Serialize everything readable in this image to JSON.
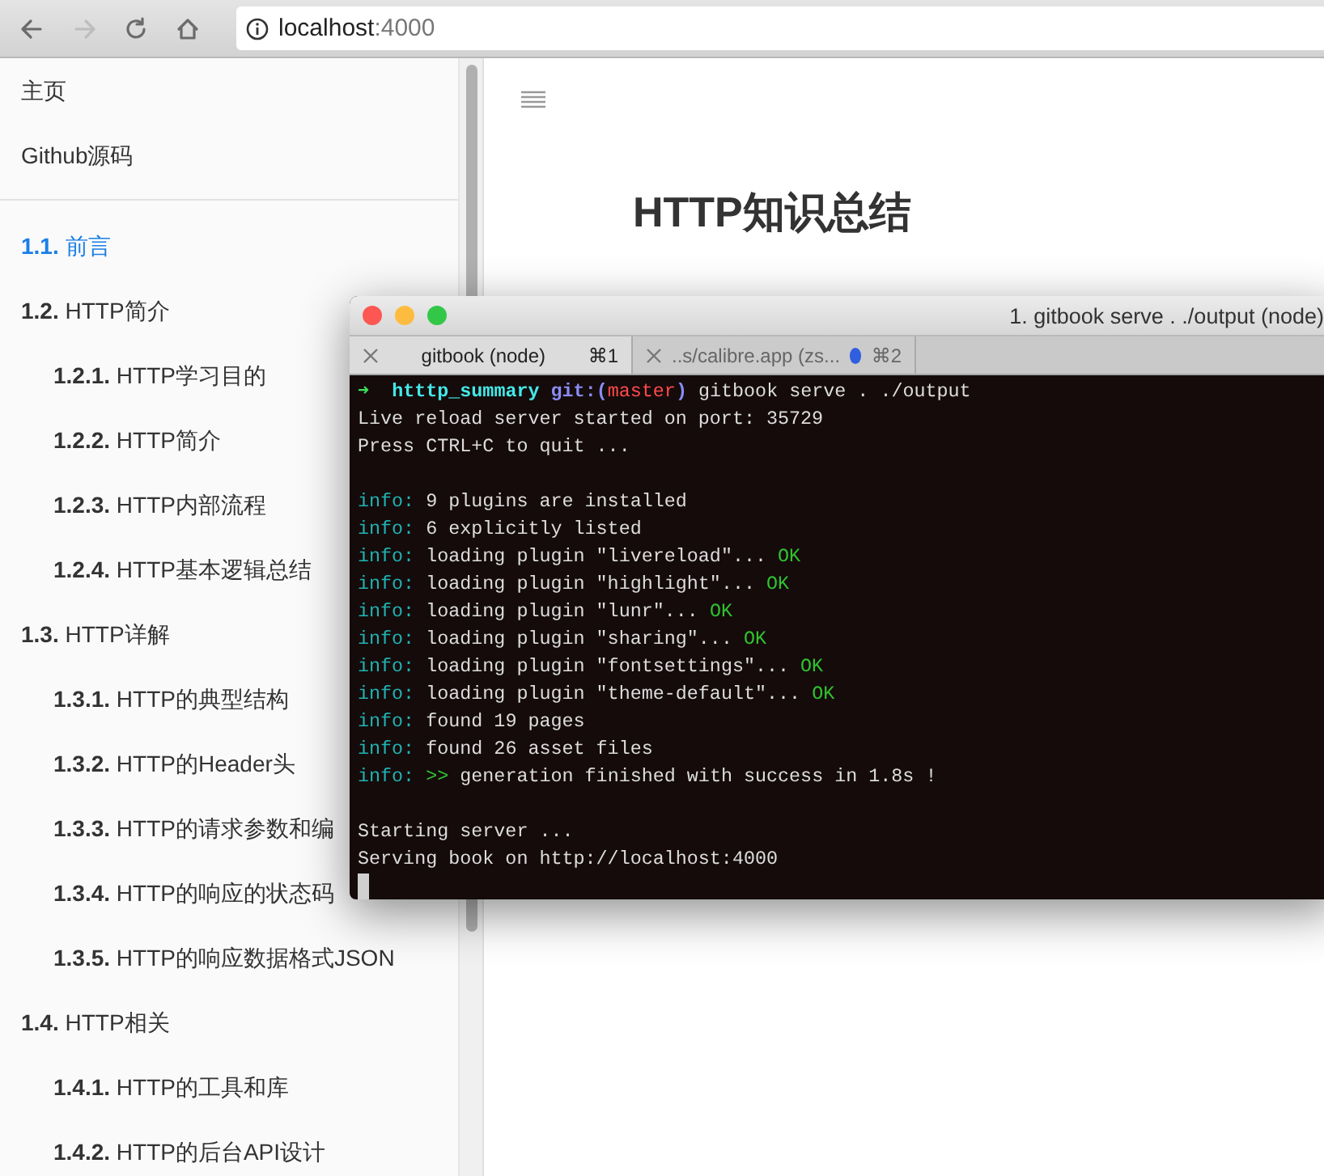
{
  "browser": {
    "nav": [
      {
        "kind": "back",
        "disabled": false
      },
      {
        "kind": "forward",
        "disabled": true
      },
      {
        "kind": "reload",
        "disabled": false
      },
      {
        "kind": "home",
        "disabled": false
      }
    ],
    "address": {
      "host": "localhost",
      "port": ":4000"
    }
  },
  "sidebar": {
    "links": [
      {
        "label": "主页"
      },
      {
        "label": "Github源码"
      }
    ],
    "items": [
      {
        "number": "1.1.",
        "label": "前言",
        "selected": true
      },
      {
        "number": "1.2.",
        "label": "HTTP简介",
        "selected": false,
        "children": [
          {
            "number": "1.2.1.",
            "label": "HTTP学习目的",
            "selected": false
          },
          {
            "number": "1.2.2.",
            "label": "HTTP简介",
            "selected": false
          },
          {
            "number": "1.2.3.",
            "label": "HTTP内部流程",
            "selected": false
          },
          {
            "number": "1.2.4.",
            "label": "HTTP基本逻辑总结",
            "selected": false
          }
        ]
      },
      {
        "number": "1.3.",
        "label": "HTTP详解",
        "selected": false,
        "children": [
          {
            "number": "1.3.1.",
            "label": "HTTP的典型结构",
            "selected": false
          },
          {
            "number": "1.3.2.",
            "label": "HTTP的Header头",
            "selected": false
          },
          {
            "number": "1.3.3.",
            "label": "HTTP的请求参数和编",
            "selected": false
          },
          {
            "number": "1.3.4.",
            "label": "HTTP的响应的状态码",
            "selected": false
          },
          {
            "number": "1.3.5.",
            "label": "HTTP的响应数据格式JSON",
            "selected": false
          }
        ]
      },
      {
        "number": "1.4.",
        "label": "HTTP相关",
        "selected": false,
        "children": [
          {
            "number": "1.4.1.",
            "label": "HTTP的工具和库",
            "selected": false
          },
          {
            "number": "1.4.2.",
            "label": "HTTP的后台API设计",
            "selected": false
          }
        ]
      }
    ]
  },
  "page": {
    "title": "HTTP知识总结"
  },
  "terminal": {
    "title": "1. gitbook serve . ./output (node)",
    "tabs": [
      {
        "label": "gitbook (node)",
        "shortcut": "⌘1",
        "selected": true,
        "activity": false
      },
      {
        "label": "..s/calibre.app (zs...",
        "shortcut": "⌘2",
        "selected": false,
        "activity": true
      }
    ],
    "lines": [
      {
        "kind": "output",
        "segments": [
          {
            "kind": "arrow",
            "text": "➜"
          },
          {
            "kind": "dir",
            "text": "htttp_summary"
          },
          {
            "kind": "git",
            "text": "git:("
          },
          {
            "kind": "branch",
            "text": "master"
          },
          {
            "kind": "git",
            "text": ")"
          },
          {
            "kind": "plain",
            "text": "gitbook serve . ./output"
          }
        ]
      },
      {
        "kind": "output",
        "segments": [
          {
            "kind": "plain",
            "text": "Live reload server started on port: 35729"
          }
        ]
      },
      {
        "kind": "output",
        "segments": [
          {
            "kind": "plain",
            "text": "Press CTRL+C to quit ..."
          }
        ]
      },
      {
        "kind": "blank"
      },
      {
        "kind": "output",
        "segments": [
          {
            "kind": "info",
            "text": "info:"
          },
          {
            "kind": "plain",
            "text": "9 plugins are installed"
          }
        ]
      },
      {
        "kind": "output",
        "segments": [
          {
            "kind": "info",
            "text": "info:"
          },
          {
            "kind": "plain",
            "text": "6 explicitly listed"
          }
        ]
      },
      {
        "kind": "output",
        "segments": [
          {
            "kind": "info",
            "text": "info:"
          },
          {
            "kind": "plain",
            "text": "loading plugin \"livereload\"..."
          },
          {
            "kind": "ok",
            "text": "OK"
          }
        ]
      },
      {
        "kind": "output",
        "segments": [
          {
            "kind": "info",
            "text": "info:"
          },
          {
            "kind": "plain",
            "text": "loading plugin \"highlight\"..."
          },
          {
            "kind": "ok",
            "text": "OK"
          }
        ]
      },
      {
        "kind": "output",
        "segments": [
          {
            "kind": "info",
            "text": "info:"
          },
          {
            "kind": "plain",
            "text": "loading plugin \"lunr\"..."
          },
          {
            "kind": "ok",
            "text": "OK"
          }
        ]
      },
      {
        "kind": "output",
        "segments": [
          {
            "kind": "info",
            "text": "info:"
          },
          {
            "kind": "plain",
            "text": "loading plugin \"sharing\"..."
          },
          {
            "kind": "ok",
            "text": "OK"
          }
        ]
      },
      {
        "kind": "output",
        "segments": [
          {
            "kind": "info",
            "text": "info:"
          },
          {
            "kind": "plain",
            "text": "loading plugin \"fontsettings\"..."
          },
          {
            "kind": "ok",
            "text": "OK"
          }
        ]
      },
      {
        "kind": "output",
        "segments": [
          {
            "kind": "info",
            "text": "info:"
          },
          {
            "kind": "plain",
            "text": "loading plugin \"theme-default\"..."
          },
          {
            "kind": "ok",
            "text": "OK"
          }
        ]
      },
      {
        "kind": "output",
        "segments": [
          {
            "kind": "info",
            "text": "info:"
          },
          {
            "kind": "plain",
            "text": "found 19 pages"
          }
        ]
      },
      {
        "kind": "output",
        "segments": [
          {
            "kind": "info",
            "text": "info:"
          },
          {
            "kind": "plain",
            "text": "found 26 asset files"
          }
        ]
      },
      {
        "kind": "output",
        "segments": [
          {
            "kind": "info",
            "text": "info:"
          },
          {
            "kind": "ok",
            "text": ">>"
          },
          {
            "kind": "plain",
            "text": "generation finished with success in 1.8s !"
          }
        ]
      },
      {
        "kind": "blank"
      },
      {
        "kind": "output",
        "segments": [
          {
            "kind": "plain",
            "text": "Starting server ..."
          }
        ]
      },
      {
        "kind": "output",
        "segments": [
          {
            "kind": "plain",
            "text": "Serving book on http://localhost:4000"
          }
        ]
      },
      {
        "kind": "output",
        "segments": [
          {
            "kind": "cursor"
          }
        ]
      }
    ]
  }
}
